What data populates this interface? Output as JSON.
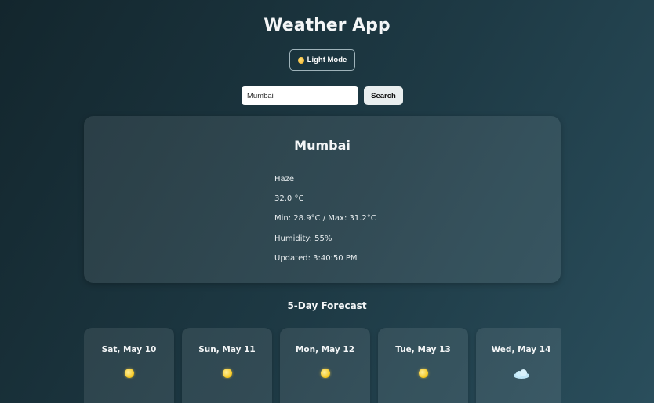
{
  "app": {
    "title": "Weather App"
  },
  "mode_toggle": {
    "label": "Light Mode",
    "icon": "sun-icon"
  },
  "search": {
    "value": "Mumbai",
    "button_label": "Search"
  },
  "current": {
    "city": "Mumbai",
    "condition": "Haze",
    "temperature": "32.0 °C",
    "min_max": "Min: 28.9°C / Max: 31.2°C",
    "humidity": "Humidity: 55%",
    "updated": "Updated: 3:40:50 PM"
  },
  "forecast": {
    "heading": "5-Day Forecast",
    "days": [
      {
        "day": "Sat, May 10",
        "icon": "sun-icon"
      },
      {
        "day": "Sun, May 11",
        "icon": "sun-icon"
      },
      {
        "day": "Mon, May 12",
        "icon": "sun-icon"
      },
      {
        "day": "Tue, May 13",
        "icon": "sun-icon"
      },
      {
        "day": "Wed, May 14",
        "icon": "cloud-icon"
      }
    ]
  }
}
